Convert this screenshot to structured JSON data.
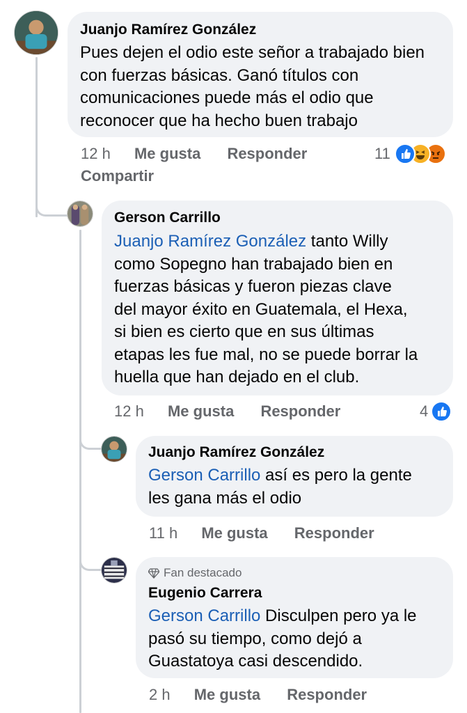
{
  "comments": [
    {
      "author": "Juanjo Ramírez González",
      "text": "Pues dejen el odio este señor a trabajado bien con fuerzas básicas. Ganó títulos con comunicaciones puede más el odio que reconocer que ha hecho buen trabajo",
      "time": "12 h",
      "like_label": "Me gusta",
      "reply_label": "Responder",
      "share_label": "Compartir",
      "reaction_count": "11",
      "reactions": [
        "like-icon",
        "haha-icon",
        "angry-icon"
      ]
    },
    {
      "author": "Gerson Carrillo",
      "mention": "Juanjo Ramírez González",
      "text_lines": [
        " tanto Willy",
        "como Sopegno han trabajado bien en",
        "fuerzas básicas y fueron piezas clave",
        "del mayor éxito en Guatemala, el Hexa,",
        "si bien es cierto que en sus últimas",
        "etapas les fue mal, no se puede borrar la",
        "huella que han dejado en el club."
      ],
      "time": "12 h",
      "like_label": "Me gusta",
      "reply_label": "Responder",
      "reaction_count": "4",
      "reactions": [
        "like-icon"
      ]
    },
    {
      "author": "Juanjo Ramírez González",
      "mention": "Gerson Carrillo",
      "text_lines": [
        " así es pero la gente",
        "les gana más el odio"
      ],
      "time": "11 h",
      "like_label": "Me gusta",
      "reply_label": "Responder"
    },
    {
      "badge": "Fan destacado",
      "author": "Eugenio Carrera",
      "mention": "Gerson Carrillo",
      "text_lines": [
        " Disculpen pero ya le",
        "pasó su tiempo,  como dejó a",
        "Guastatoya casi descendido."
      ],
      "time": "2 h",
      "like_label": "Me gusta",
      "reply_label": "Responder"
    }
  ],
  "colors": {
    "bubble": "#f0f2f5",
    "mention": "#1b5fb5",
    "meta": "#65676b",
    "like": "#1877f2",
    "haha": "#f7b125",
    "angry": "#e9710f"
  }
}
